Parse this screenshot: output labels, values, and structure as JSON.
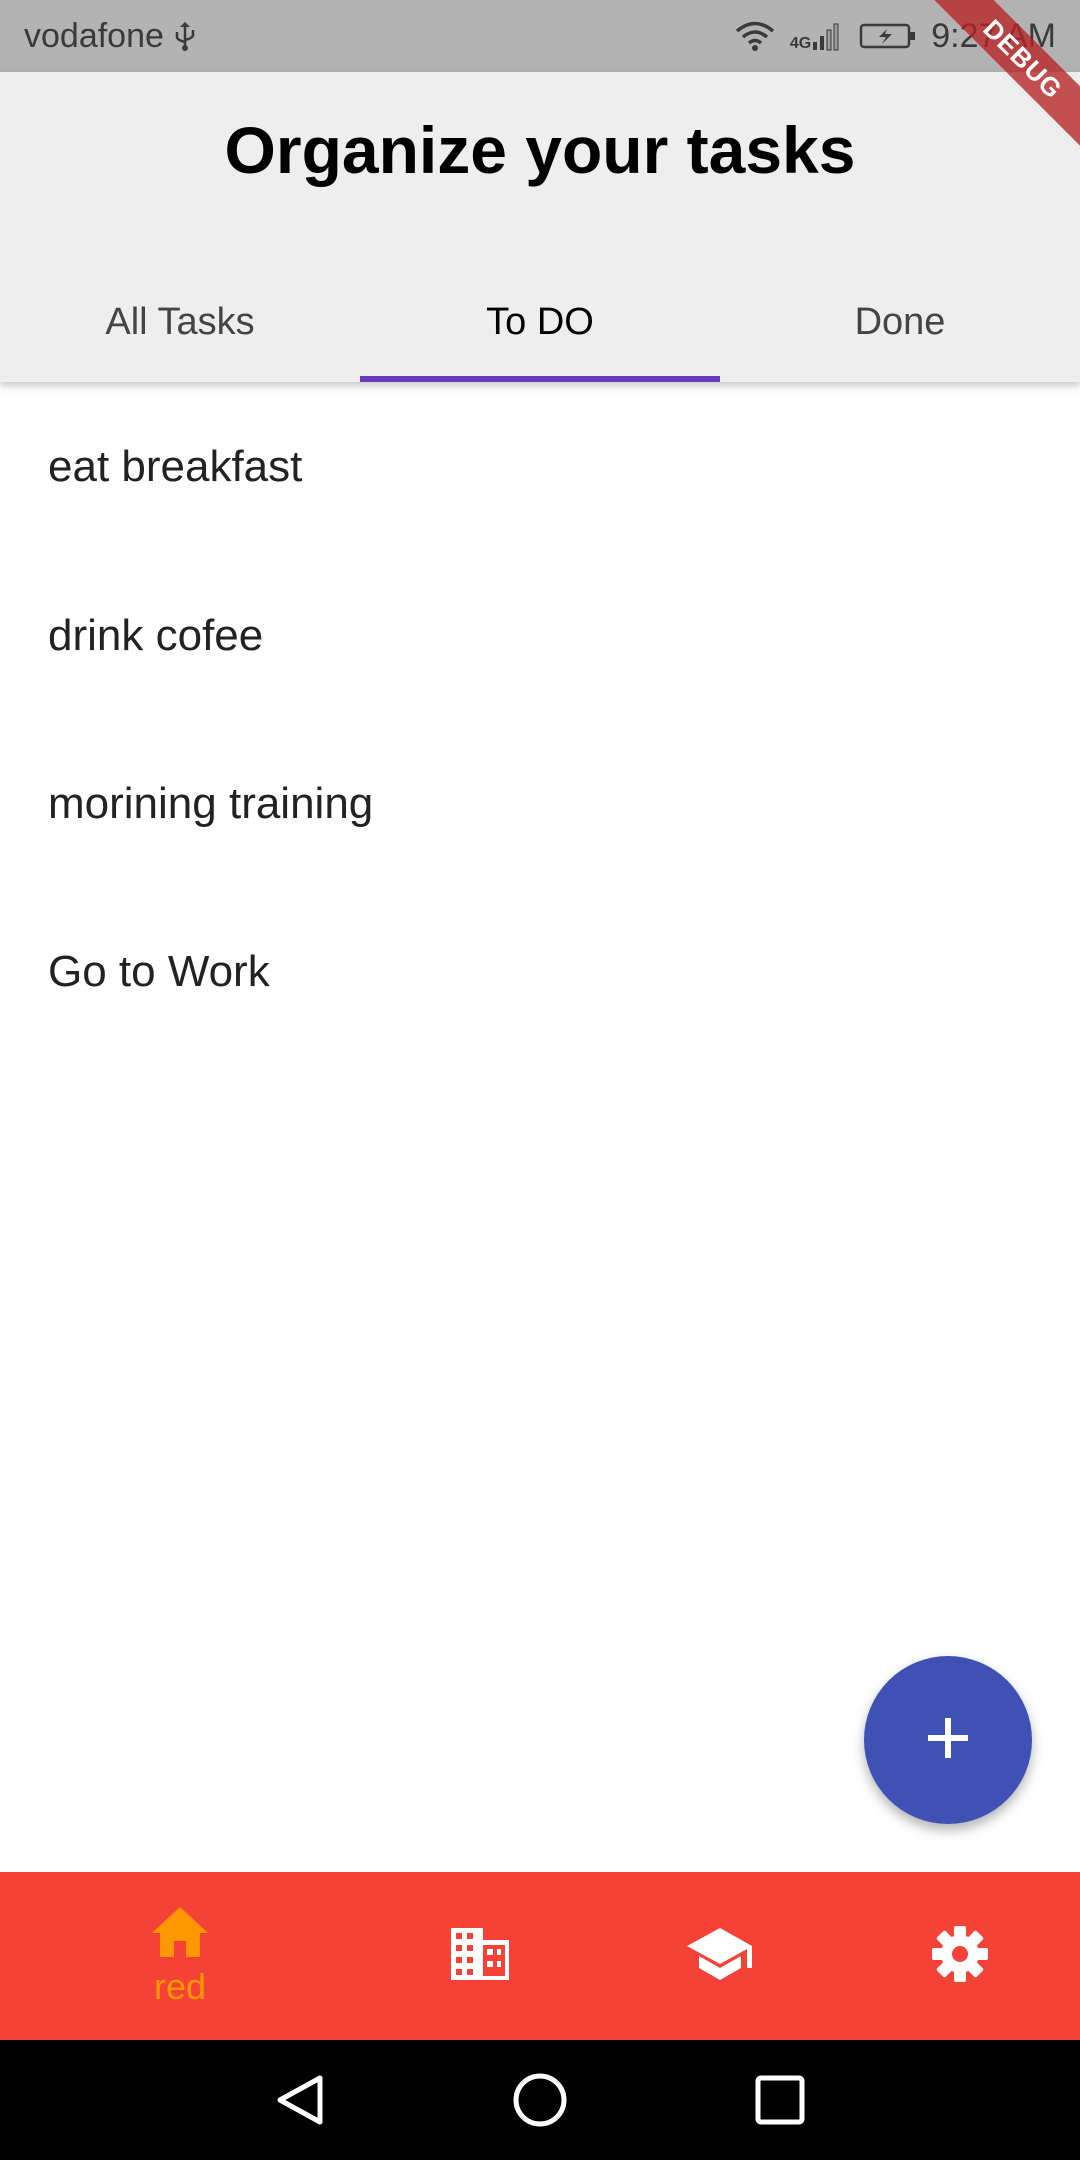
{
  "status_bar": {
    "carrier": "vodafone",
    "network": "4G",
    "time": "9:27 AM"
  },
  "debug_banner": "DEBUG",
  "app_bar": {
    "title": "Organize your tasks",
    "tabs": [
      {
        "label": "All Tasks",
        "selected": false
      },
      {
        "label": "To DO",
        "selected": true
      },
      {
        "label": "Done",
        "selected": false
      }
    ]
  },
  "tasks": [
    {
      "title": "eat breakfast"
    },
    {
      "title": "drink cofee"
    },
    {
      "title": "morining training"
    },
    {
      "title": "Go to Work"
    }
  ],
  "fab": {
    "icon": "plus-icon"
  },
  "bottom_nav": {
    "items": [
      {
        "icon": "home-icon",
        "label": "red",
        "selected": true
      },
      {
        "icon": "business-icon",
        "label": "",
        "selected": false
      },
      {
        "icon": "school-icon",
        "label": "",
        "selected": false
      },
      {
        "icon": "settings-icon",
        "label": "",
        "selected": false
      }
    ]
  },
  "system_nav": {
    "items": [
      "back-icon",
      "home-circle-icon",
      "recents-icon"
    ]
  },
  "colors": {
    "status_bar": "#b3b3b3",
    "app_bar": "#eeeeee",
    "tab_indicator": "#673ab7",
    "fab": "#3f51b5",
    "bottom_nav": "#f44336",
    "bottom_nav_selected": "#ff9800",
    "debug_ribbon": "#b72424"
  }
}
